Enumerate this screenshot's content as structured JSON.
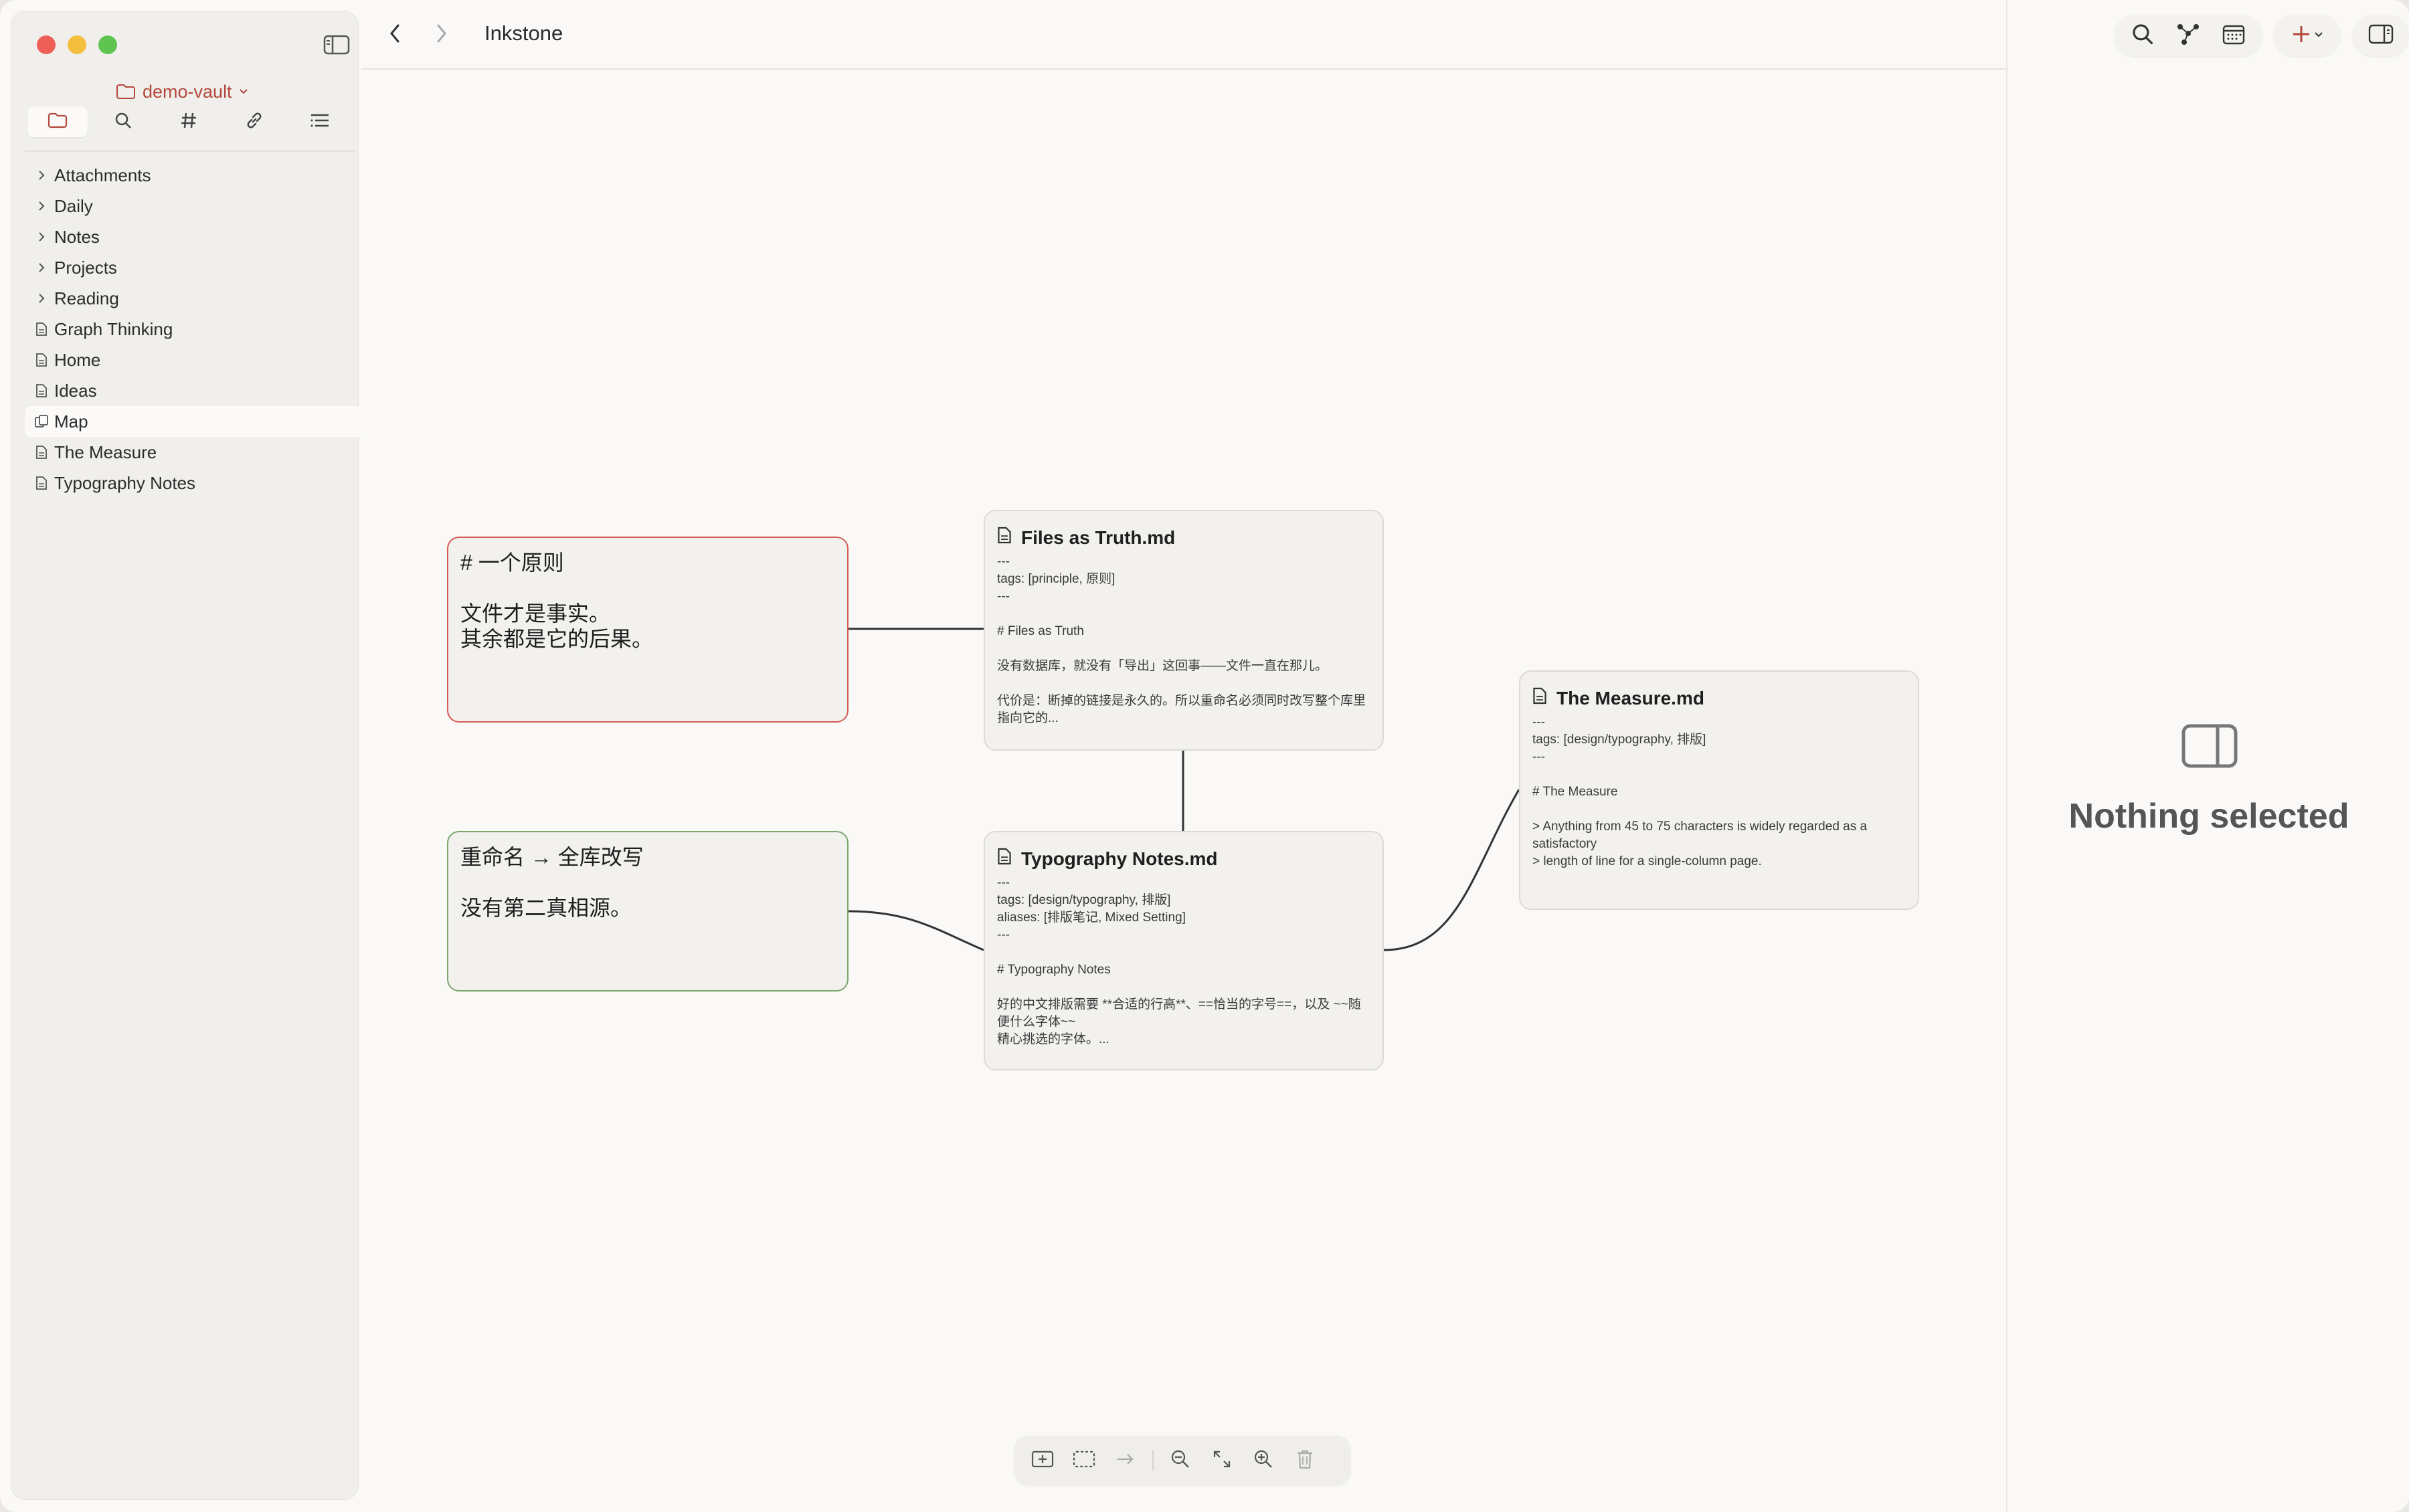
{
  "app": {
    "title": "Inkstone"
  },
  "sidebar": {
    "vault_name": "demo-vault",
    "tabs": [
      {
        "name": "files",
        "icon": "folder-icon"
      },
      {
        "name": "search",
        "icon": "search-icon"
      },
      {
        "name": "tags",
        "icon": "hash-icon"
      },
      {
        "name": "links",
        "icon": "link-icon"
      },
      {
        "name": "outline",
        "icon": "outline-icon"
      }
    ],
    "items": [
      {
        "label": "Attachments",
        "kind": "folder"
      },
      {
        "label": "Daily",
        "kind": "folder"
      },
      {
        "label": "Notes",
        "kind": "folder"
      },
      {
        "label": "Projects",
        "kind": "folder"
      },
      {
        "label": "Reading",
        "kind": "folder"
      },
      {
        "label": "Graph Thinking",
        "kind": "file"
      },
      {
        "label": "Home",
        "kind": "file"
      },
      {
        "label": "Ideas",
        "kind": "file"
      },
      {
        "label": "Map",
        "kind": "canvas",
        "active": true
      },
      {
        "label": "The Measure",
        "kind": "file"
      },
      {
        "label": "Typography Notes",
        "kind": "file"
      }
    ]
  },
  "canvas": {
    "cards": {
      "principle": {
        "text": "# 一个原则\n\n文件才是事实。\n其余都是它的后果。",
        "color": "#d45c55"
      },
      "rename": {
        "text": "重命名 → 全库改写\n\n没有第二真相源。",
        "color": "#7aa66e"
      },
      "files_truth": {
        "title": "Files as Truth.md",
        "body": "---\ntags: [principle, 原则]\n---\n\n# Files as Truth\n\n没有数据库，就没有「导出」这回事——文件一直在那儿。\n\n代价是：断掉的链接是永久的。所以重命名必须同时改写整个库里指向它的..."
      },
      "typography": {
        "title": "Typography Notes.md",
        "body": "---\ntags: [design/typography, 排版]\naliases: [排版笔记, Mixed Setting]\n---\n\n# Typography Notes\n\n好的中文排版需要 **合适的行高**、==恰当的字号==，以及 ~~随便什么字体~~\n精心挑选的字体。..."
      },
      "measure": {
        "title": "The Measure.md",
        "body": "---\ntags: [design/typography, 排版]\n---\n\n# The Measure\n\n> Anything from 45 to 75 characters is widely regarded as a satisfactory\n> length of line for a single-column page."
      }
    }
  },
  "inspector": {
    "empty_text": "Nothing selected"
  },
  "colors": {
    "accent": "#b2473b",
    "red_card": "#d45c55",
    "green_card": "#7aa66e"
  }
}
